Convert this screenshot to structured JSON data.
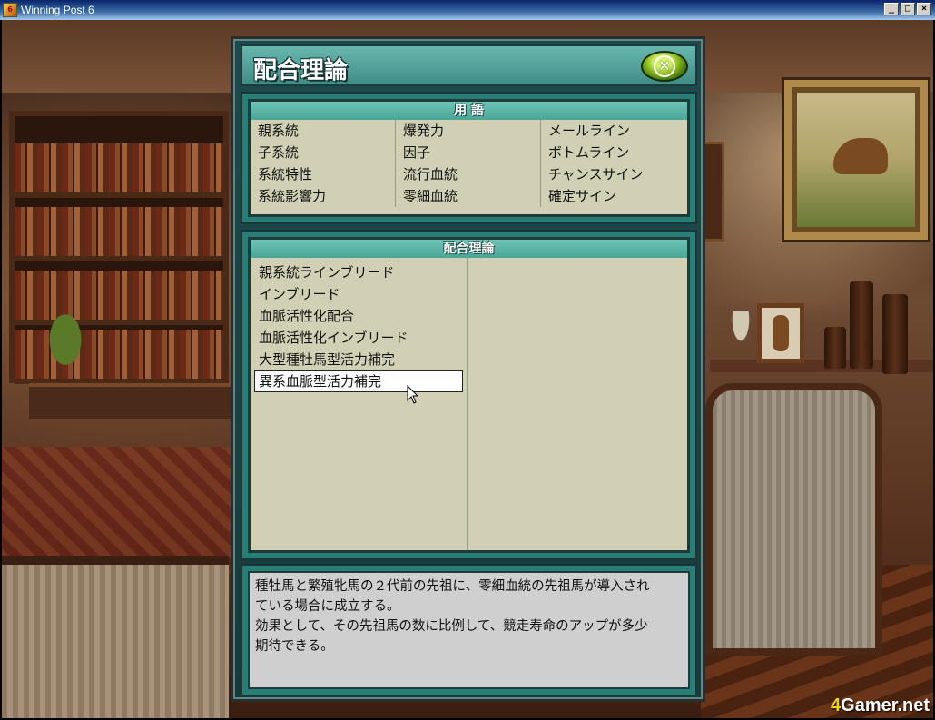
{
  "window": {
    "title": "Winning Post 6",
    "icon_text": "6",
    "buttons": {
      "minimize": "_",
      "maximize": "□",
      "close": "×"
    }
  },
  "panel": {
    "title": "配合理論",
    "close_icon": "circle-x-icon",
    "close_glyph": "✕"
  },
  "terms": {
    "header": "用 語",
    "columns": [
      [
        "親系統",
        "子系統",
        "系統特性",
        "系統影響力"
      ],
      [
        "爆発力",
        "因子",
        "流行血統",
        "零細血統"
      ],
      [
        "メールライン",
        "ボトムライン",
        "チャンスサイン",
        "確定サイン"
      ]
    ]
  },
  "theory": {
    "header": "配合理論",
    "items": [
      "親系統ラインブリード",
      "インブリード",
      "血脈活性化配合",
      "血脈活性化インブリード",
      "大型種牡馬型活力補完",
      "異系血脈型活力補完"
    ],
    "selected_index": 5
  },
  "description": {
    "lines": [
      "種牡馬と繁殖牝馬の２代前の先祖に、零細血統の先祖馬が導入され",
      "ている場合に成立する。",
      "効果として、その先祖馬の数に比例して、競走寿命のアップが多少",
      "期待できる。"
    ]
  },
  "watermark": {
    "prefix": "4",
    "text": "Gamer.net"
  },
  "colors": {
    "panel_teal": "#2a7e78",
    "header_teal": "#6ec4b6",
    "list_bg": "#d2d0b4",
    "desc_bg": "#cfcfcf",
    "close_green": "#8ec020"
  }
}
